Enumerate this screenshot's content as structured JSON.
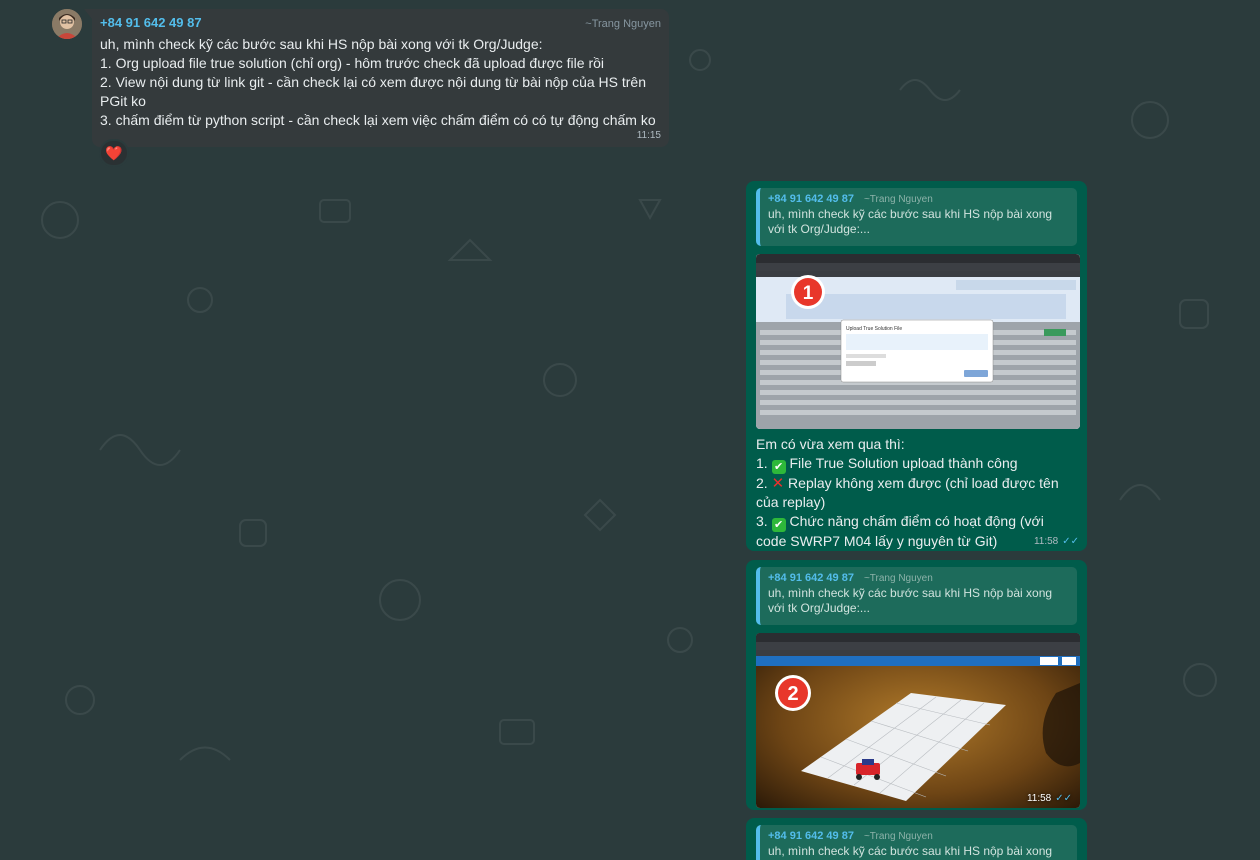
{
  "incoming": {
    "sender_phone": "+84 91 642 49 87",
    "sender_name": "~Trang Nguyen",
    "lines": [
      "uh, mình check kỹ các bước sau khi HS nộp bài xong với tk Org/Judge:",
      "1. Org upload file true solution (chỉ org) - hôm trước check đã upload được file rồi",
      "2. View nội dung từ link git - cần check lại có xem được nội dung từ bài nộp của HS trên PGit ko",
      "3. chấm điểm từ python script - cần check lại xem việc chấm điểm có có tự động chấm ko"
    ],
    "time": "11:15",
    "reaction": "❤️"
  },
  "outgoing": [
    {
      "quote_phone": "+84 91 642 49 87",
      "quote_name": "~Trang Nguyen",
      "quote_text": "uh, mình check kỹ các bước sau khi HS nộp bài xong với tk Org/Judge:...",
      "image_badge": "1",
      "dialog_title": "Upload True Solution File",
      "intro": "Em có vừa xem qua thì:",
      "items": [
        {
          "mark": "✅",
          "text": "File True Solution upload thành công"
        },
        {
          "mark": "❌",
          "text": "Replay không xem được (chỉ load được tên của replay)"
        },
        {
          "mark": "✅",
          "text": "Chức năng chấm điểm có hoạt động (với code SWRP7 M04 lấy y nguyên từ Git)"
        }
      ],
      "time": "11:58"
    },
    {
      "quote_phone": "+84 91 642 49 87",
      "quote_name": "~Trang Nguyen",
      "quote_text": "uh, mình check kỹ các bước sau khi HS nộp bài xong với tk Org/Judge:...",
      "image_badge": "2",
      "time": "11:58"
    },
    {
      "quote_phone": "+84 91 642 49 87",
      "quote_name": "~Trang Nguyen",
      "quote_text": "uh, mình check kỹ các bước sau khi HS nộp bài xong với"
    }
  ],
  "colors": {
    "background": "#2b3b3c",
    "incoming_bubble": "#343a3c",
    "outgoing_bubble": "#005c4b",
    "accent": "#53bdeb"
  }
}
